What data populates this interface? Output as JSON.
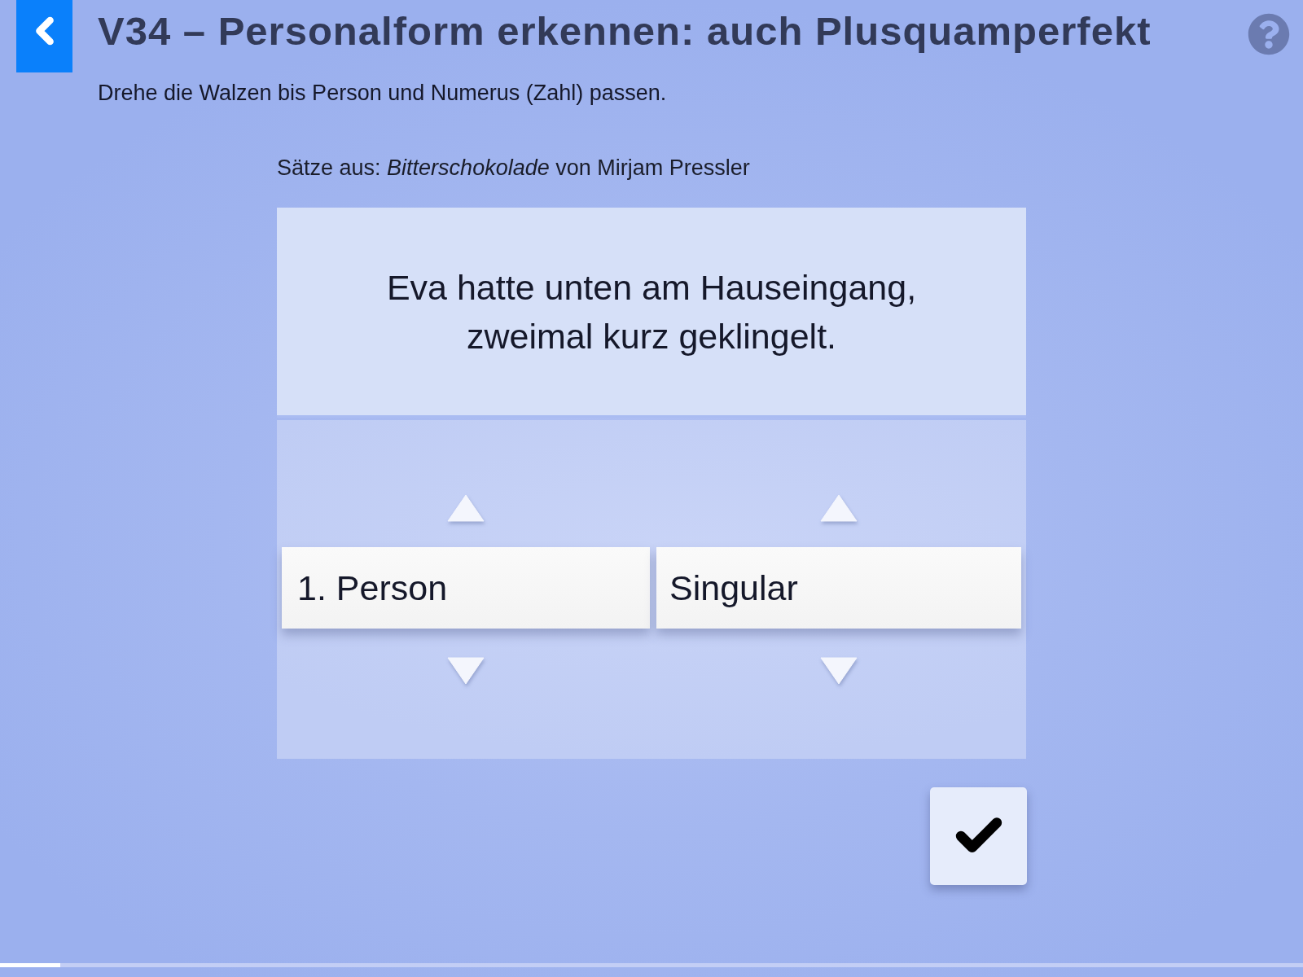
{
  "header": {
    "title": "V34 – Personalform erkennen: auch Plusquamperfekt",
    "instruction": "Drehe die Walzen bis Person und Numerus (Zahl) passen."
  },
  "source": "Sätze aus: *Bitterschokolade* von Mirjam Pressler",
  "sentence": "Eva hatte unten am Hauseingang, zweimal kurz geklingelt.",
  "reels": [
    {
      "value": "1. Person"
    },
    {
      "value": "Singular"
    }
  ],
  "progress": {
    "level": 0.046
  }
}
